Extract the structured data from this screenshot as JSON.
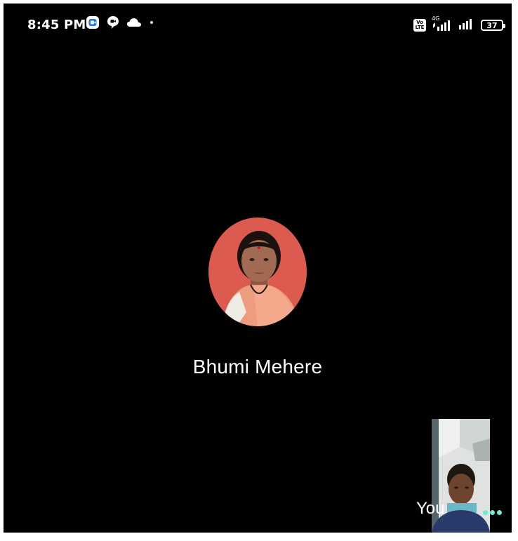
{
  "status_bar": {
    "time": "8:45 PM",
    "left_icons": [
      "meet-icon",
      "chat-bubble-icon",
      "cloud-icon",
      "dot-icon"
    ],
    "volte": [
      "Vo",
      "LTE"
    ],
    "network": "4G",
    "battery": "37"
  },
  "call": {
    "contact_name": "Bhumi Mehere",
    "self_label": "You"
  },
  "colors": {
    "background": "#000000",
    "accent": "#6fe8d8",
    "avatar_bg": "#d9544c"
  }
}
